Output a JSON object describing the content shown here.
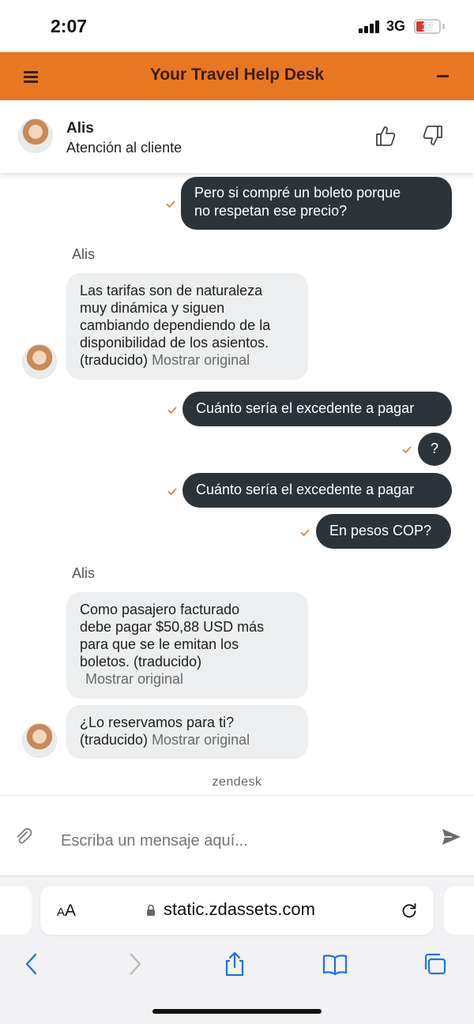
{
  "status_bar": {
    "time": "2:07",
    "network": "3G",
    "battery": "17"
  },
  "header": {
    "title": "Your Travel Help Desk"
  },
  "agent": {
    "name": "Alis",
    "role": "Atención al cliente"
  },
  "messages": {
    "out_1": {
      "line1": "Pero si compré un boleto porque",
      "line2": "no respetan ese precio?"
    },
    "sender_1": "Alis",
    "in_1": {
      "line1": "Las tarifas son de naturaleza",
      "line2": "muy dinámica y siguen",
      "line3": "cambiando dependiendo de la",
      "line4": "disponibilidad de los asientos.",
      "translated": "(traducido)",
      "show_original": "Mostrar original"
    },
    "out_2": "Cuánto sería el excedente a pagar",
    "out_3": "?",
    "out_4": "Cuánto sería el excedente a pagar",
    "out_5": "En pesos COP?",
    "sender_2": "Alis",
    "in_2": {
      "line1": "Como pasajero facturado",
      "line2": "debe pagar $50,88 USD más",
      "line3": "para que se le emitan los",
      "line4": "boletos. (traducido)",
      "show_original": "Mostrar original"
    },
    "in_3": {
      "line1": "¿Lo reservamos para ti?",
      "translated": "(traducido)",
      "show_original": "Mostrar original"
    }
  },
  "branding": "zendesk",
  "composer": {
    "placeholder": "Escriba un mensaje aquí..."
  },
  "browser": {
    "aa_small": "A",
    "aa_big": "A",
    "url": "static.zdassets.com"
  },
  "colors": {
    "header": "#e87722",
    "outgoing_bubble": "#2c343a",
    "incoming_bubble": "#eceeef",
    "check": "#c8823a",
    "ios_blue": "#1a73e8"
  },
  "icons": {
    "menu": "hamburger-icon",
    "minimize": "minus-icon",
    "thumbs_up": "thumbs-up-icon",
    "thumbs_down": "thumbs-down-icon",
    "attach": "paperclip-icon",
    "send": "send-icon",
    "lock": "lock-icon",
    "reload": "reload-icon",
    "back": "chevron-left-icon",
    "forward": "chevron-right-icon",
    "share": "share-icon",
    "bookmarks": "book-icon",
    "tabs": "tabs-icon"
  }
}
